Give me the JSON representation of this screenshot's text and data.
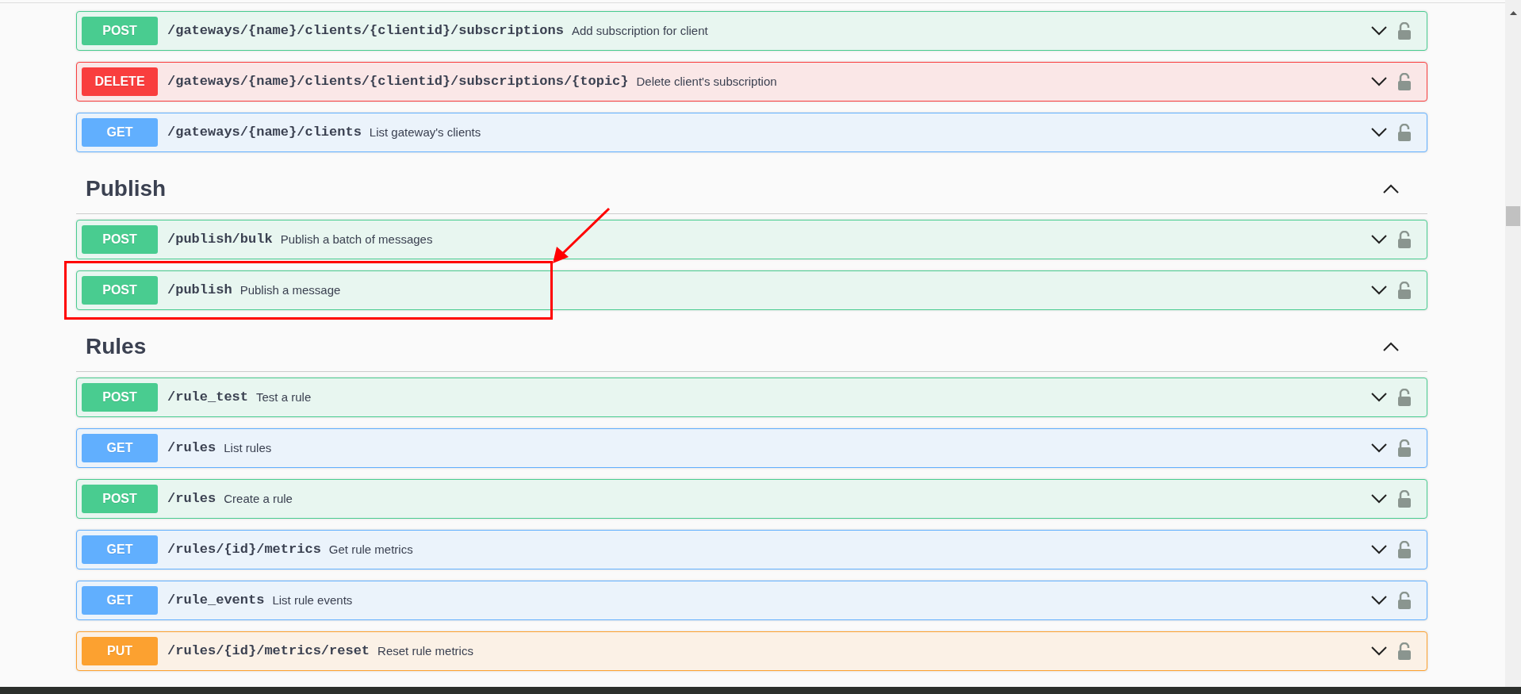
{
  "sections": [
    {
      "operations": [
        {
          "method": "POST",
          "path": "/gateways/{name}/clients/{clientid}/subscriptions",
          "summary": "Add subscription for client",
          "expanded": false,
          "annotated": false
        },
        {
          "method": "DELETE",
          "path": "/gateways/{name}/clients/{clientid}/subscriptions/{topic}",
          "summary": "Delete client's subscription",
          "expanded": false,
          "annotated": false
        },
        {
          "method": "GET",
          "path": "/gateways/{name}/clients",
          "summary": "List gateway's clients",
          "expanded": false,
          "annotated": false
        }
      ]
    },
    {
      "title": "Publish",
      "expanded": true,
      "operations": [
        {
          "method": "POST",
          "path": "/publish/bulk",
          "summary": "Publish a batch of messages",
          "expanded": false,
          "annotated": false
        },
        {
          "method": "POST",
          "path": "/publish",
          "summary": "Publish a message",
          "expanded": false,
          "annotated": true
        }
      ]
    },
    {
      "title": "Rules",
      "expanded": true,
      "operations": [
        {
          "method": "POST",
          "path": "/rule_test",
          "summary": "Test a rule",
          "expanded": false,
          "annotated": false
        },
        {
          "method": "GET",
          "path": "/rules",
          "summary": "List rules",
          "expanded": false,
          "annotated": false
        },
        {
          "method": "POST",
          "path": "/rules",
          "summary": "Create a rule",
          "expanded": false,
          "annotated": false
        },
        {
          "method": "GET",
          "path": "/rules/{id}/metrics",
          "summary": "Get rule metrics",
          "expanded": false,
          "annotated": false
        },
        {
          "method": "GET",
          "path": "/rule_events",
          "summary": "List rule events",
          "expanded": false,
          "annotated": false
        },
        {
          "method": "PUT",
          "path": "/rules/{id}/metrics/reset",
          "summary": "Reset rule metrics",
          "expanded": false,
          "annotated": false
        }
      ]
    }
  ]
}
